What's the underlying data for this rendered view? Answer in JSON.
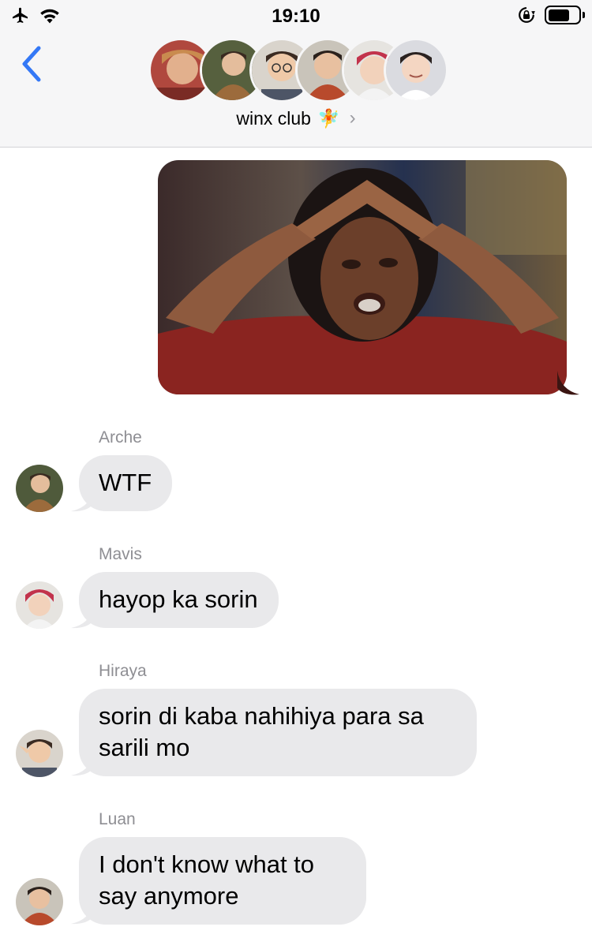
{
  "status_bar": {
    "time": "19:10"
  },
  "header": {
    "group_name": "winx club",
    "group_emoji": "🧚",
    "back_icon": "chevron-left-icon",
    "chevron": "›"
  },
  "accent_color": "#3478f6",
  "bubble_color": "#e9e9eb",
  "messages": [
    {
      "type": "image",
      "from": "me",
      "content": "oprah-reaction-photo"
    },
    {
      "sender": "Arche",
      "text": "WTF"
    },
    {
      "sender": "Mavis",
      "text": "hayop ka sorin"
    },
    {
      "sender": "Hiraya",
      "text": "sorin di kaba nahihiya para sa sarili mo"
    },
    {
      "sender": "Luan",
      "text": "I don't know what to say anymore"
    }
  ]
}
